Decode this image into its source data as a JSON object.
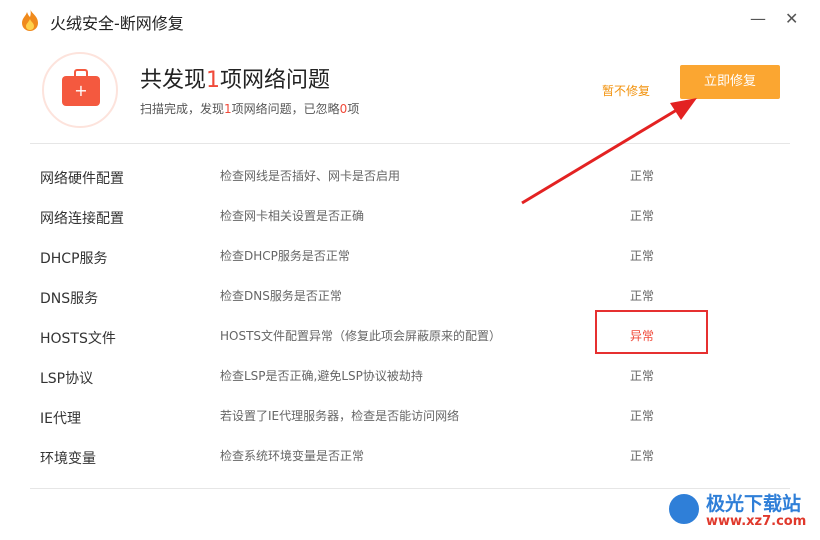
{
  "window": {
    "title": "火绒安全-断网修复",
    "minimize": "—",
    "close": "✕"
  },
  "header": {
    "summary_prefix": "共发现",
    "summary_count": "1",
    "summary_suffix": "项网络问题",
    "sub_a": "扫描完成，发现",
    "sub_found": "1",
    "sub_b": "项网络问题，已忽略",
    "sub_ignored": "0",
    "sub_c": "项",
    "skip_label": "暂不修复",
    "fix_label": "立即修复",
    "icon": "first-aid-kit-icon",
    "kit_plus": "+"
  },
  "items": [
    {
      "name": "网络硬件配置",
      "desc": "检查网线是否插好、网卡是否启用",
      "status": "正常"
    },
    {
      "name": "网络连接配置",
      "desc": "检查网卡相关设置是否正确",
      "status": "正常"
    },
    {
      "name": "DHCP服务",
      "desc": "检查DHCP服务是否正常",
      "status": "正常"
    },
    {
      "name": "DNS服务",
      "desc": "检查DNS服务是否正常",
      "status": "正常"
    },
    {
      "name": "HOSTS文件",
      "desc": "HOSTS文件配置异常（修复此项会屏蔽原来的配置）",
      "status": "异常"
    },
    {
      "name": "LSP协议",
      "desc": "检查LSP是否正确,避免LSP协议被劫持",
      "status": "正常"
    },
    {
      "name": "IE代理",
      "desc": "若设置了IE代理服务器，检查是否能访问网络",
      "status": "正常"
    },
    {
      "name": "环境变量",
      "desc": "检查系统环境变量是否正常",
      "status": "正常"
    }
  ],
  "watermark": {
    "text": "极光下载站",
    "url": "www.xz7.com"
  },
  "colors": {
    "accent": "#fba631",
    "alert": "#f04a3a",
    "annotation": "#e63030",
    "brand": "#f4593f"
  }
}
